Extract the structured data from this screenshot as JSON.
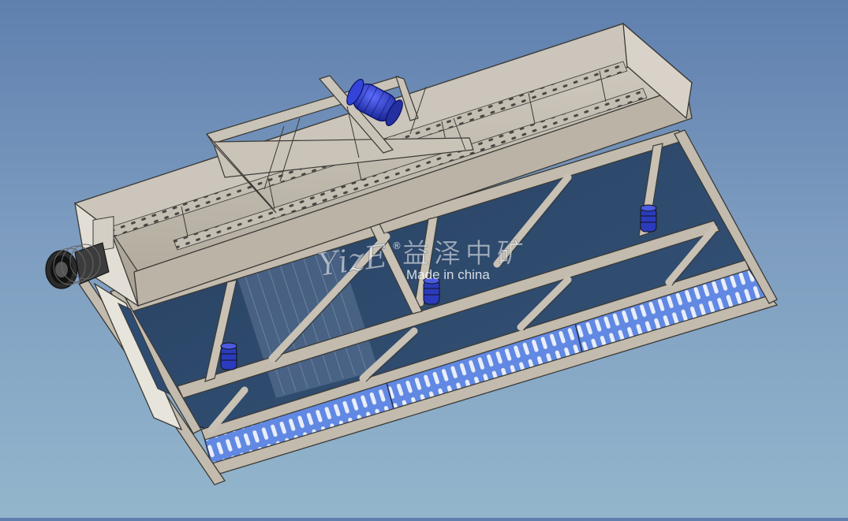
{
  "watermark": {
    "logo_text": "YizE",
    "registered_mark": "®",
    "chinese_text": "益泽中矿",
    "tagline": "Made in china"
  },
  "colors": {
    "background_top": "#5f7fae",
    "background_bottom": "#93b6cc",
    "trough_steel": "#c8c2b8",
    "frame_steel": "#b5aea2",
    "screen_panel": "#2a4363",
    "perforated_plate": "#5d86e0",
    "motor": "#2f3fd0",
    "edge_line": "#3a3a3a"
  },
  "components": [
    {
      "id": "trough",
      "icon": "feed-trough-icon"
    },
    {
      "id": "motor",
      "icon": "vibration-motor-icon"
    },
    {
      "id": "inlet",
      "icon": "inlet-pipe-icon"
    },
    {
      "id": "screen",
      "icon": "screen-deck-icon"
    },
    {
      "id": "springs",
      "icon": "spring-damper-icon"
    }
  ]
}
